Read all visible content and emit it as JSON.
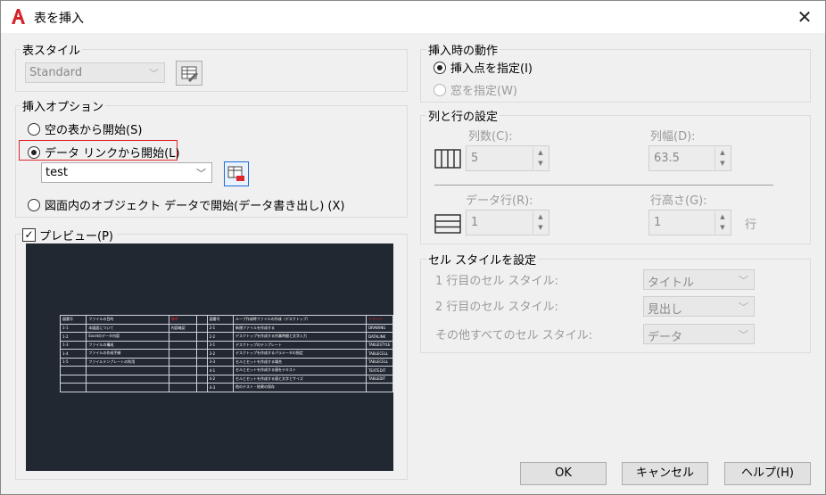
{
  "window": {
    "title": "表を挿入"
  },
  "table_style": {
    "group_label": "表スタイル",
    "selected": "Standard"
  },
  "insert_options": {
    "group_label": "挿入オプション",
    "empty_table": "空の表から開始(S)",
    "data_link": "データ リンクから開始(L)",
    "data_link_value": "test",
    "object_data": "図面内のオブジェクト データで開始(データ書き出し) (X)"
  },
  "preview": {
    "label": "プレビュー(P)",
    "checked": true,
    "rows": [
      [
        "図番号",
        "ファイルの目的",
        "備考",
        "",
        "図番号",
        "ループ作成時ファイルの作成（デスクトップ）",
        "ドライバ"
      ],
      [
        "1-1",
        "本図面について",
        "内容確認",
        "",
        "2-1",
        "新規ファイルを作成する",
        "DRAWING"
      ],
      [
        "1-2",
        "Excelのデータ内容",
        "",
        "",
        "2-2",
        "デスクトップを作成する作業時間と文字入力",
        "DATALINK"
      ],
      [
        "1-3",
        "ファイルの構成",
        "",
        "",
        "3-1",
        "デスクトップのテンプレート",
        "TABLESTYLE"
      ],
      [
        "1-4",
        "ファイルの作成手順",
        "",
        "",
        "3-2",
        "デスクトップを作成するパラメータの指定",
        "TABLECELL"
      ],
      [
        "1-5",
        "ファイルテンプレートの利用",
        "",
        "",
        "3-3",
        "セルとセットを作成する場合",
        "TABLECELL"
      ],
      [
        "",
        "",
        "",
        "",
        "4-1",
        "セルとセットを作成する値をテキスト",
        "TEXTEDIT"
      ],
      [
        "",
        "",
        "",
        "",
        "4-2",
        "セルとセットを作成する値と文字とサイズ",
        "TABLEDIT"
      ],
      [
        "",
        "",
        "",
        "",
        "4-3",
        "他のテスト・結果の保存",
        ""
      ]
    ]
  },
  "insertion_behavior": {
    "group_label": "挿入時の動作",
    "insert_point": "挿入点を指定(I)",
    "window": "窓を指定(W)"
  },
  "columns_rows": {
    "group_label": "列と行の設定",
    "columns_label": "列数(C):",
    "columns_value": "5",
    "col_width_label": "列幅(D):",
    "col_width_value": "63.5",
    "data_rows_label": "データ行(R):",
    "data_rows_value": "1",
    "row_height_label": "行高さ(G):",
    "row_height_value": "1",
    "row_unit": "行"
  },
  "cell_styles": {
    "group_label": "セル スタイルを設定",
    "first_row_label": "1 行目のセル スタイル:",
    "first_row_value": "タイトル",
    "second_row_label": "2 行目のセル スタイル:",
    "second_row_value": "見出し",
    "other_rows_label": "その他すべてのセル スタイル:",
    "other_rows_value": "データ"
  },
  "buttons": {
    "ok": "OK",
    "cancel": "キャンセル",
    "help": "ヘルプ(H)"
  },
  "colors": {
    "highlight_red": "#e0262b",
    "preview_bg": "#222832"
  }
}
